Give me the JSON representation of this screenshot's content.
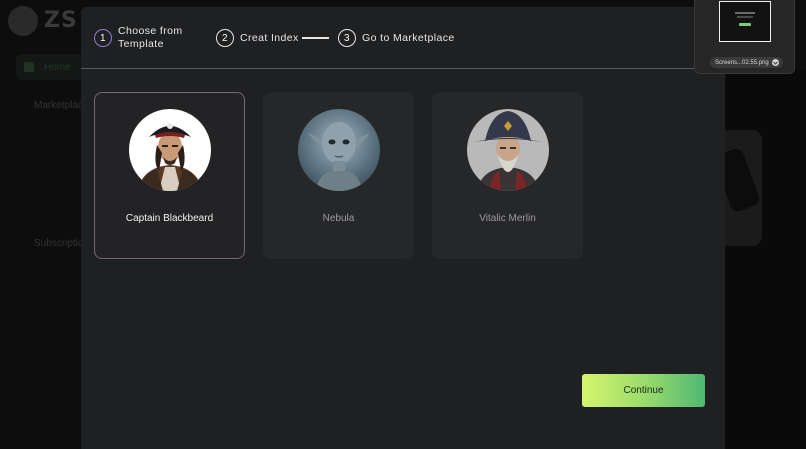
{
  "background": {
    "logo_text": "ZS",
    "nav": [
      "Home",
      "Marketplace",
      "Subscription"
    ]
  },
  "stepper": {
    "steps": [
      {
        "number": "1",
        "label": "Choose from Template"
      },
      {
        "number": "2",
        "label": "Creat Index"
      },
      {
        "number": "3",
        "label": "Go to Marketplace"
      }
    ],
    "active_step": 1
  },
  "templates": [
    {
      "name": "Captain Blackbeard",
      "selected": true
    },
    {
      "name": "Nebula",
      "selected": false
    },
    {
      "name": "Vitalic Merlin",
      "selected": false
    }
  ],
  "continue_label": "Continue",
  "screenshot_popup": {
    "file_label": "Screens...02.55.png"
  },
  "colors": {
    "accent_purple": "#8f7fd6",
    "continue_gradient_start": "#d6f56d",
    "continue_gradient_end": "#4fb872",
    "modal_bg": "#1f2022"
  }
}
